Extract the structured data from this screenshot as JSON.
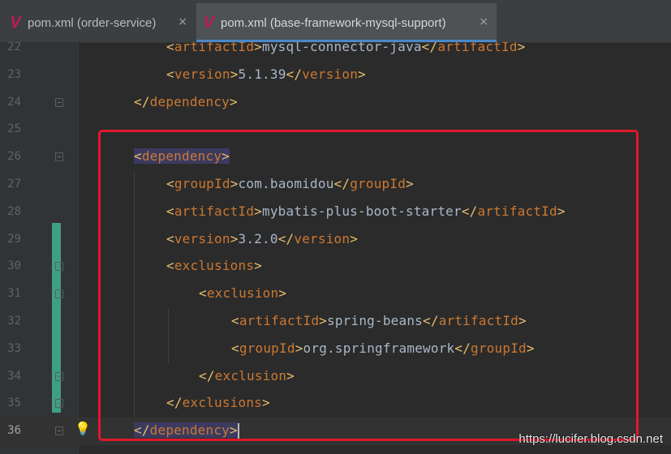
{
  "tabs": [
    {
      "label": "pom.xml (order-service)",
      "close": "×",
      "active": false,
      "icon": "maven-icon"
    },
    {
      "label": "pom.xml (base-framework-mysql-support)",
      "close": "×",
      "active": true,
      "icon": "maven-icon"
    }
  ],
  "tab_icon_glyph": "V",
  "lines": [
    {
      "num": "22",
      "indent": 2,
      "parts": [
        [
          "tg",
          "<"
        ],
        [
          "tn",
          "artifactId"
        ],
        [
          "tg",
          ">"
        ],
        [
          "tx",
          "mysql-connector-java"
        ],
        [
          "tg",
          "</"
        ],
        [
          "tn",
          "artifactId"
        ],
        [
          "tg",
          ">"
        ]
      ]
    },
    {
      "num": "23",
      "indent": 2,
      "parts": [
        [
          "tg",
          "<"
        ],
        [
          "tn",
          "version"
        ],
        [
          "tg",
          ">"
        ],
        [
          "tx",
          "5.1.39"
        ],
        [
          "tg",
          "</"
        ],
        [
          "tn",
          "version"
        ],
        [
          "tg",
          ">"
        ]
      ]
    },
    {
      "num": "24",
      "indent": 1,
      "parts": [
        [
          "tg",
          "</"
        ],
        [
          "tn",
          "dependency"
        ],
        [
          "tg",
          ">"
        ]
      ]
    },
    {
      "num": "25",
      "indent": 0,
      "parts": []
    },
    {
      "num": "26",
      "indent": 1,
      "parts": [
        [
          "tg hl",
          "<"
        ],
        [
          "tn hl",
          "dependency"
        ],
        [
          "tg hl",
          ">"
        ]
      ]
    },
    {
      "num": "27",
      "indent": 2,
      "parts": [
        [
          "tg",
          "<"
        ],
        [
          "tn",
          "groupId"
        ],
        [
          "tg",
          ">"
        ],
        [
          "tx",
          "com.baomidou"
        ],
        [
          "tg",
          "</"
        ],
        [
          "tn",
          "groupId"
        ],
        [
          "tg",
          ">"
        ]
      ]
    },
    {
      "num": "28",
      "indent": 2,
      "parts": [
        [
          "tg",
          "<"
        ],
        [
          "tn",
          "artifactId"
        ],
        [
          "tg",
          ">"
        ],
        [
          "tx",
          "mybatis-plus-boot-starter"
        ],
        [
          "tg",
          "</"
        ],
        [
          "tn",
          "artifactId"
        ],
        [
          "tg",
          ">"
        ]
      ]
    },
    {
      "num": "29",
      "indent": 2,
      "parts": [
        [
          "tg",
          "<"
        ],
        [
          "tn",
          "version"
        ],
        [
          "tg",
          ">"
        ],
        [
          "tx",
          "3.2.0"
        ],
        [
          "tg",
          "</"
        ],
        [
          "tn",
          "version"
        ],
        [
          "tg",
          ">"
        ]
      ]
    },
    {
      "num": "30",
      "indent": 2,
      "parts": [
        [
          "tg",
          "<"
        ],
        [
          "tn",
          "exclusions"
        ],
        [
          "tg",
          ">"
        ]
      ]
    },
    {
      "num": "31",
      "indent": 3,
      "parts": [
        [
          "tg",
          "<"
        ],
        [
          "tn",
          "exclusion"
        ],
        [
          "tg",
          ">"
        ]
      ]
    },
    {
      "num": "32",
      "indent": 4,
      "parts": [
        [
          "tg",
          "<"
        ],
        [
          "tn",
          "artifactId"
        ],
        [
          "tg",
          ">"
        ],
        [
          "tx",
          "spring-beans"
        ],
        [
          "tg",
          "</"
        ],
        [
          "tn",
          "artifactId"
        ],
        [
          "tg",
          ">"
        ]
      ]
    },
    {
      "num": "33",
      "indent": 4,
      "parts": [
        [
          "tg",
          "<"
        ],
        [
          "tn",
          "groupId"
        ],
        [
          "tg",
          ">"
        ],
        [
          "tx",
          "org.springframework"
        ],
        [
          "tg",
          "</"
        ],
        [
          "tn",
          "groupId"
        ],
        [
          "tg",
          ">"
        ]
      ]
    },
    {
      "num": "34",
      "indent": 3,
      "parts": [
        [
          "tg",
          "</"
        ],
        [
          "tn",
          "exclusion"
        ],
        [
          "tg",
          ">"
        ]
      ]
    },
    {
      "num": "35",
      "indent": 2,
      "parts": [
        [
          "tg",
          "</"
        ],
        [
          "tn",
          "exclusions"
        ],
        [
          "tg",
          ">"
        ]
      ]
    },
    {
      "num": "36",
      "indent": 1,
      "parts": [
        [
          "tg hl",
          "</"
        ],
        [
          "tn hl",
          "dependency"
        ],
        [
          "tg hl",
          ">"
        ]
      ]
    }
  ],
  "current_line": "36",
  "watermark": "https://lucifer.blog.csdn.net"
}
